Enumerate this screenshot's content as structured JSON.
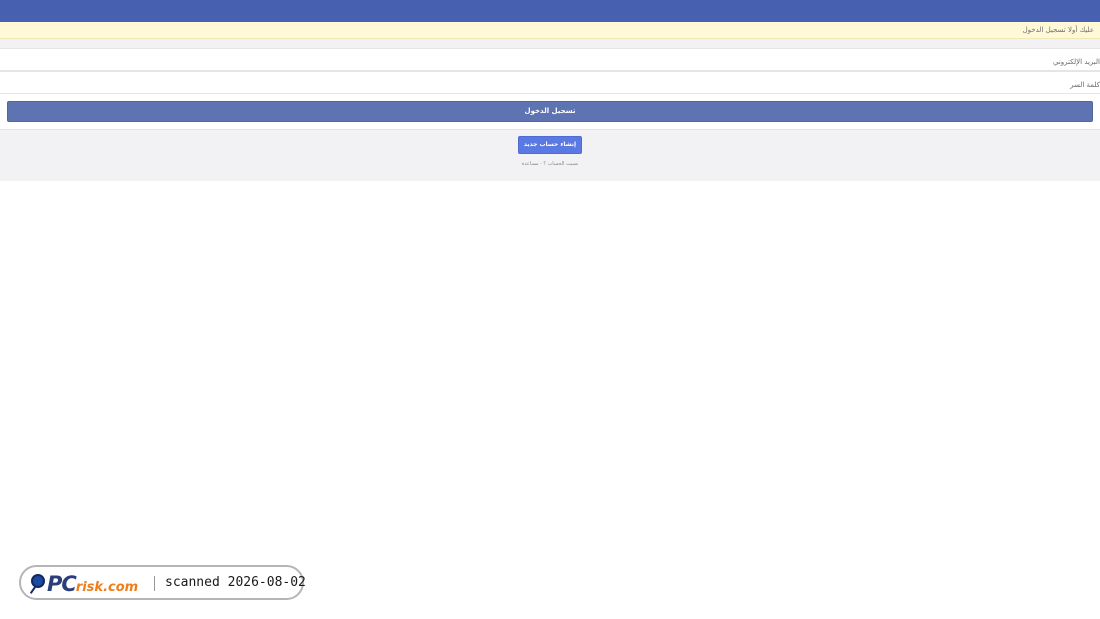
{
  "notice": {
    "text": "عليك أولا تسجيل الدخول"
  },
  "form": {
    "email_placeholder": "البريد الإلكتروني",
    "password_placeholder": "كلمة السر",
    "login_label": "تسجيل الدخول"
  },
  "lower": {
    "create_account_label": "إنشاء حساب جديد",
    "forgot_account": "نسيت الحساب ؟",
    "help": "مساعدة"
  },
  "watermark": {
    "logo_pc": "PC",
    "logo_risk": "risk.com",
    "scanned": "scanned 2026-08-02"
  },
  "colors": {
    "topbar": "#4760b0",
    "login_button": "#5d73b2",
    "create_button": "#5b79e3",
    "notice_bg": "#fff9d7"
  }
}
